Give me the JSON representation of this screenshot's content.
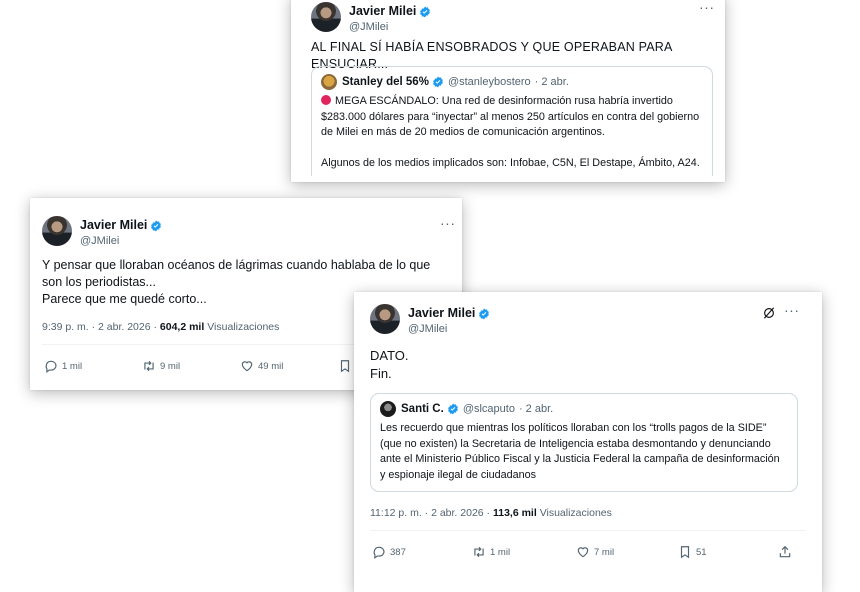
{
  "tweet1": {
    "name": "Javier Milei",
    "handle": "@JMilei",
    "text": "AL FINAL SÍ HABÍA ENSOBRADOS Y QUE OPERABAN PARA ENSUCIAR...",
    "quote": {
      "name": "Stanley del 56%",
      "handle": "@stanleybostero",
      "date": "· 2 abr.",
      "text": "MEGA ESCÁNDALO: Una red de desinformación rusa habría invertido $283.000 dólares para “inyectar” al menos 250 artículos en contra del gobierno de Milei en más de 20 medios de comunicación argentinos.\n\nAlgunos de los medios implicados son: Infobae, C5N, El Destape, Ámbito, A24."
    }
  },
  "tweet2": {
    "name": "Javier Milei",
    "handle": "@JMilei",
    "text": "Y pensar que lloraban océanos de lágrimas cuando hablaba de lo que son los periodistas...\nParece que me quedé corto...",
    "time": "9:39 p. m. · 2 abr. 2026 ·",
    "views": "604,2 mil",
    "views_label": "Visualizaciones",
    "replies": "1 mil",
    "retweets": "9 mil",
    "likes": "49 mil"
  },
  "tweet3": {
    "name": "Javier Milei",
    "handle": "@JMilei",
    "text": "DATO.\nFin.",
    "quote": {
      "name": "Santi C.",
      "handle": "@slcaputo",
      "date": "· 2 abr.",
      "text": "Les recuerdo que mientras los políticos lloraban con los “trolls pagos de la SIDE” (que no existen) la Secretaria de Inteligencia estaba desmontando y denunciando ante el Ministerio Público Fiscal y la Justicia Federal la campaña de desinformación y espionaje ilegal de ciudadanos"
    },
    "time": "11:12 p. m. · 2 abr. 2026 ·",
    "views": "113,6 mil",
    "views_label": "Visualizaciones",
    "replies": "387",
    "retweets": "1 mil",
    "likes": "7 mil",
    "bookmarks": "51"
  },
  "icons": {
    "verified_color": "#1d9bf0",
    "more": "more-icon",
    "reply": "reply-icon",
    "retweet": "retweet-icon",
    "like": "like-icon",
    "bookmark": "bookmark-icon",
    "share": "share-icon",
    "grok": "grok-icon"
  },
  "more_glyph": "···"
}
